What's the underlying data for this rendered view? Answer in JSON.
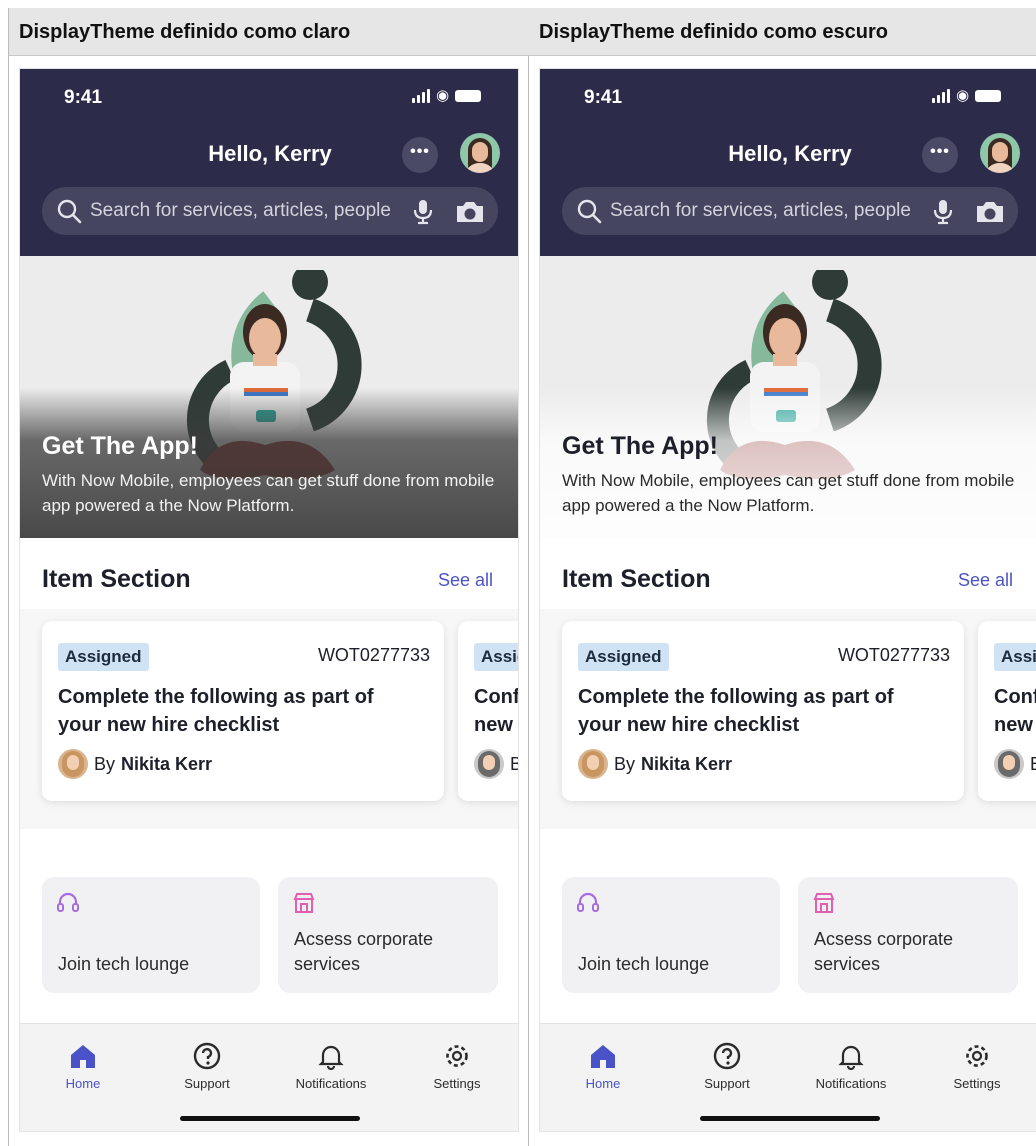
{
  "columns": [
    {
      "header": "DisplayTheme definido como claro",
      "phone": {
        "status": {
          "time": "9:41"
        },
        "greeting": "Hello, Kerry",
        "more_label": "•••",
        "search_placeholder": "Search for services, articles, people",
        "hero": {
          "title": "Get The App!",
          "body": "With Now Mobile, employees can get stuff done from mobile app powered a the Now Platform."
        },
        "section": {
          "title": "Item Section",
          "see_all": "See all"
        },
        "cards": [
          {
            "badge": "Assigned",
            "number": "WOT0277733",
            "title": "Complete the following as part of your new hire checklist",
            "by": "By",
            "author": "Nikita Kerr"
          },
          {
            "badge": "Assig",
            "title": "Conf new",
            "by": "B"
          }
        ],
        "tiles": [
          {
            "label": "Join tech lounge",
            "icon": "headset-icon"
          },
          {
            "label": "Acsess corporate services",
            "icon": "storefront-icon"
          }
        ],
        "tabs": [
          {
            "label": "Home",
            "icon": "home-icon",
            "active": true
          },
          {
            "label": "Support",
            "icon": "help-circle-icon"
          },
          {
            "label": "Notifications",
            "icon": "bell-icon"
          },
          {
            "label": "Settings",
            "icon": "gear-icon"
          }
        ]
      }
    },
    {
      "header": "DisplayTheme definido como escuro",
      "phone": {
        "status": {
          "time": "9:41"
        },
        "greeting": "Hello, Kerry",
        "more_label": "•••",
        "search_placeholder": "Search for services, articles, people",
        "hero": {
          "title": "Get The App!",
          "body": "With Now Mobile, employees can get stuff done from mobile app powered a the Now Platform."
        },
        "section": {
          "title": "Item Section",
          "see_all": "See all"
        },
        "cards": [
          {
            "badge": "Assigned",
            "number": "WOT0277733",
            "title": "Complete the following as part of your new hire checklist",
            "by": "By",
            "author": "Nikita Kerr"
          },
          {
            "badge": "Assig",
            "title": "Conf new",
            "by": "E"
          }
        ],
        "tiles": [
          {
            "label": "Join tech lounge",
            "icon": "headset-icon"
          },
          {
            "label": "Acsess corporate services",
            "icon": "storefront-icon"
          }
        ],
        "tabs": [
          {
            "label": "Home",
            "icon": "home-icon",
            "active": true
          },
          {
            "label": "Support",
            "icon": "help-circle-icon"
          },
          {
            "label": "Notifications",
            "icon": "bell-icon"
          },
          {
            "label": "Settings",
            "icon": "gear-icon"
          }
        ]
      }
    }
  ],
  "colors": {
    "header_bg": "#2c2c4a",
    "accent": "#4a52c8",
    "badge_bg": "#cfe3f4",
    "tile_icon_purple": "#a66de0",
    "tile_icon_pink": "#e05fb0"
  }
}
